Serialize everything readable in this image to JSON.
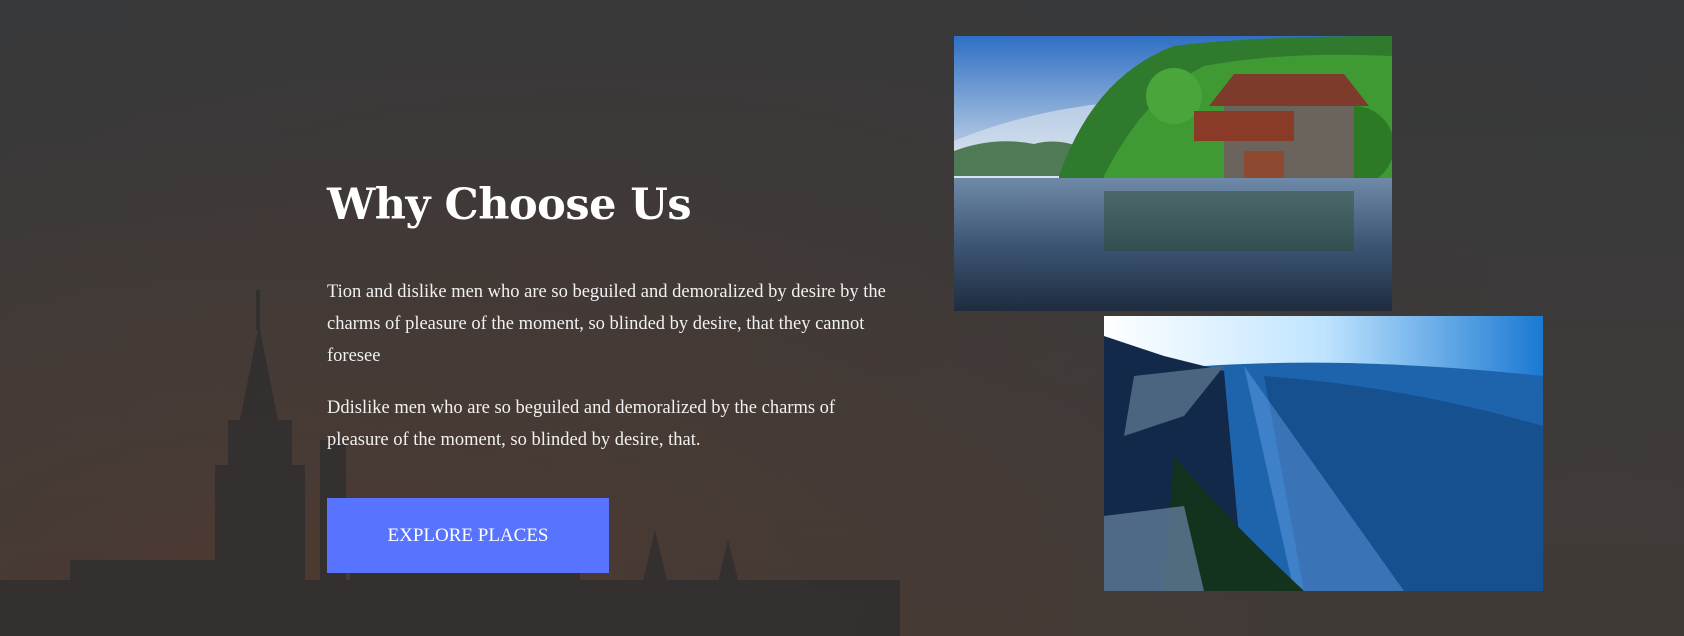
{
  "section": {
    "title": "Why Choose Us",
    "paragraphs": [
      "Tion and dislike men who are so beguiled and demoralized by desire by the charms of pleasure of the moment, so blinded by desire, that they cannot foresee",
      "Ddislike men who are so beguiled and demoralized by the charms of pleasure of the moment, so blinded by desire, that."
    ],
    "cta_label": "EXPLORE PLACES"
  },
  "colors": {
    "cta_background": "#5874ff",
    "overlay": "#3a3a3b",
    "text": "#ffffff"
  },
  "images": {
    "top": "lake-boathouse-photo",
    "bottom": "mountain-valley-photo",
    "background": "castle-silhouette-background"
  }
}
